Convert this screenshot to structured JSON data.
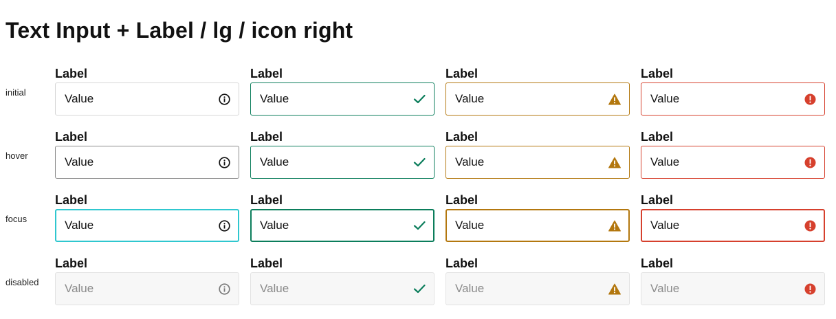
{
  "page": {
    "title": "Text Input + Label / lg / icon right"
  },
  "field_label": "Label",
  "field_value": "Value",
  "states": [
    {
      "id": "initial",
      "label": "initial"
    },
    {
      "id": "hover",
      "label": "hover"
    },
    {
      "id": "focus",
      "label": "focus"
    },
    {
      "id": "disabled",
      "label": "disabled"
    }
  ],
  "variants": [
    {
      "id": "default",
      "icon": "info-icon",
      "color": "#111111"
    },
    {
      "id": "success",
      "icon": "checkmark-icon",
      "color": "#0b7d5b"
    },
    {
      "id": "warning",
      "icon": "warning-icon",
      "color": "#b3770e"
    },
    {
      "id": "error",
      "icon": "error-icon",
      "color": "#d6402d"
    }
  ],
  "colors": {
    "focus_default": "#2fc7cf",
    "hover_default": "#8a8a8a",
    "disabled_bg": "#f7f7f7",
    "disabled_text": "#8a8a8a"
  }
}
